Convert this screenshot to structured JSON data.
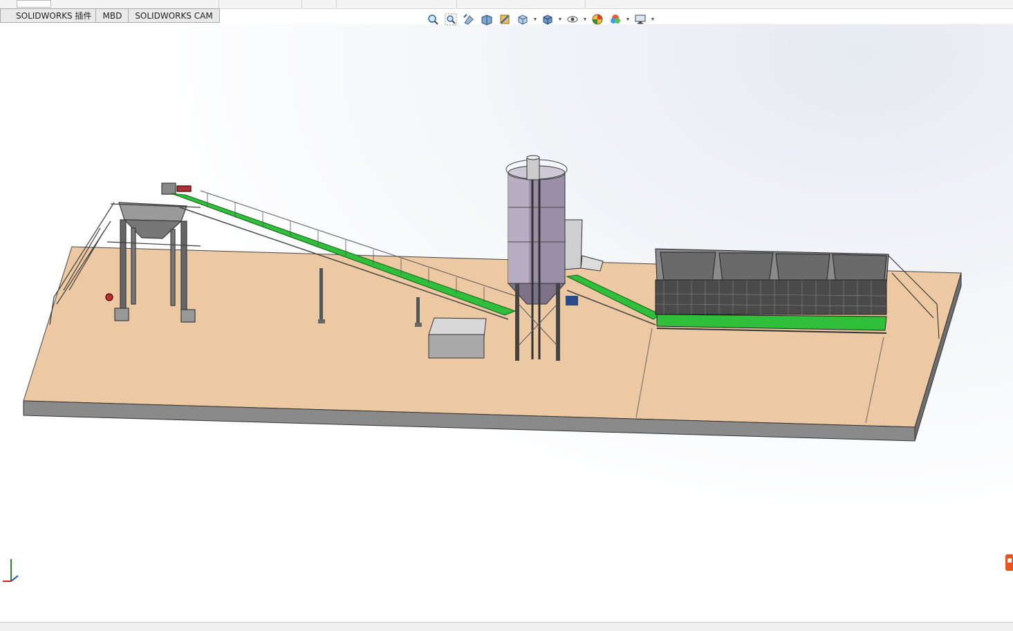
{
  "ribbon_tabs": [
    {
      "label": "SOLIDWORKS 插件"
    },
    {
      "label": "MBD"
    },
    {
      "label": "SOLIDWORKS CAM"
    }
  ],
  "heads_up_toolbar": [
    {
      "icon": "zoom-to-fit-icon",
      "dropdown": false
    },
    {
      "icon": "zoom-to-area-icon",
      "dropdown": false
    },
    {
      "icon": "previous-view-icon",
      "dropdown": false
    },
    {
      "icon": "section-view-icon",
      "dropdown": false
    },
    {
      "icon": "dynamic-annotation-icon",
      "dropdown": false
    },
    {
      "icon": "view-orientation-icon",
      "dropdown": true
    },
    {
      "icon": "display-style-icon",
      "dropdown": true
    },
    {
      "icon": "hide-show-items-icon",
      "dropdown": true
    },
    {
      "icon": "edit-appearance-icon",
      "dropdown": false
    },
    {
      "icon": "apply-scene-icon",
      "dropdown": true
    },
    {
      "icon": "view-settings-icon",
      "dropdown": true
    }
  ],
  "colors": {
    "ground_top": "#edc9a3",
    "ground_side": "#8a8a8a",
    "conveyor_belt": "#2fbf3a",
    "steel": "#555555",
    "hopper": "#6d6d6d"
  }
}
